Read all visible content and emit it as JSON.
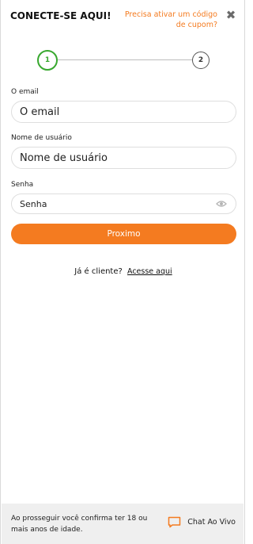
{
  "header": {
    "title": "CONECTE-SE AQUI!",
    "coupon_link": "Precisa ativar um código de cupom?",
    "close_icon": "close-icon"
  },
  "stepper": {
    "steps": [
      "1",
      "2"
    ],
    "active_step": 1
  },
  "form": {
    "email": {
      "label": "O email",
      "placeholder": "O email"
    },
    "username": {
      "label": "Nome de usuário",
      "placeholder": "Nome de usuário"
    },
    "password": {
      "label": "Senha",
      "placeholder": "Senha",
      "icon": "eye-icon"
    },
    "submit_label": "Proximo"
  },
  "login": {
    "prompt": "Já é cliente?",
    "link": "Acesse aqui"
  },
  "footer": {
    "age_notice": "Ao prosseguir você confirma ter 18 ou mais anos de idade.",
    "chat_label": "Chat Ao Vivo",
    "chat_icon": "chat-bubble-icon"
  },
  "colors": {
    "accent": "#f47b20",
    "step_active": "#38a82f"
  }
}
